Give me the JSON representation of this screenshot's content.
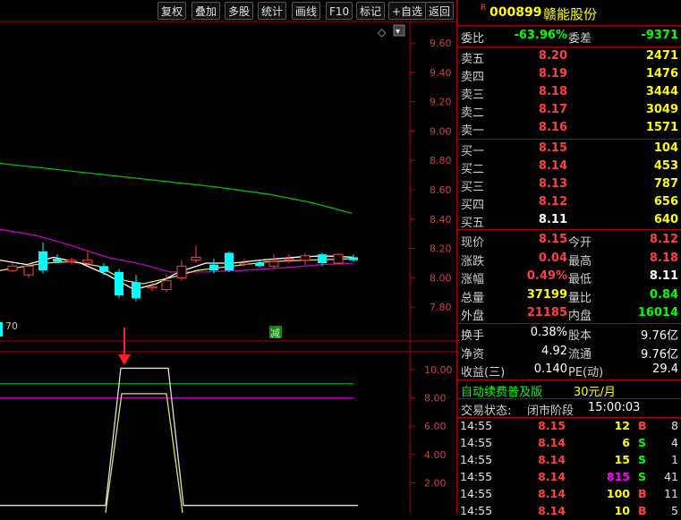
{
  "toolbar": {
    "buttons": [
      "复权",
      "叠加",
      "多股",
      "统计",
      "画线",
      "F10",
      "标记",
      "+自选",
      "返回"
    ]
  },
  "chart": {
    "price_axis": [
      "9.60",
      "9.40",
      "9.20",
      "9.00",
      "8.80",
      "8.60",
      "8.40",
      "8.20",
      "8.00",
      "7.80"
    ],
    "indicator_axis": [
      "10.00",
      "8.00",
      "6.00",
      "4.00",
      "2.00"
    ],
    "left_label": "70",
    "marker_text": "减",
    "diamond_icon": "◇",
    "dropdown_icon": "▾"
  },
  "stock": {
    "badge": "R",
    "code": "000899",
    "name": "赣能股份",
    "weibi_label": "委比",
    "weibi": "-63.96%",
    "weicha_label": "委差",
    "weicha": "-9371"
  },
  "asks": [
    {
      "label": "卖五",
      "price": "8.20",
      "vol": "2471"
    },
    {
      "label": "卖四",
      "price": "8.19",
      "vol": "1476"
    },
    {
      "label": "卖三",
      "price": "8.18",
      "vol": "3444"
    },
    {
      "label": "卖二",
      "price": "8.17",
      "vol": "3049"
    },
    {
      "label": "卖一",
      "price": "8.16",
      "vol": "1571"
    }
  ],
  "bids": [
    {
      "label": "买一",
      "price": "8.15",
      "vol": "104"
    },
    {
      "label": "买二",
      "price": "8.14",
      "vol": "453"
    },
    {
      "label": "买三",
      "price": "8.13",
      "vol": "787"
    },
    {
      "label": "买四",
      "price": "8.12",
      "vol": "656"
    },
    {
      "label": "买五",
      "price": "8.11",
      "vol": "640"
    }
  ],
  "quote": [
    {
      "l1": "现价",
      "v1": "8.15",
      "c1": "red",
      "l2": "今开",
      "v2": "8.12",
      "c2": "red"
    },
    {
      "l1": "涨跌",
      "v1": "0.04",
      "c1": "red",
      "l2": "最高",
      "v2": "8.18",
      "c2": "red"
    },
    {
      "l1": "涨幅",
      "v1": "0.49%",
      "c1": "red",
      "l2": "最低",
      "v2": "8.11",
      "c2": "white"
    },
    {
      "l1": "总量",
      "v1": "37199",
      "c1": "yellow",
      "l2": "量比",
      "v2": "0.84",
      "c2": "green"
    },
    {
      "l1": "外盘",
      "v1": "21185",
      "c1": "red",
      "l2": "内盘",
      "v2": "16014",
      "c2": "green"
    }
  ],
  "fundamentals": [
    {
      "l1": "换手",
      "v1": "0.38%",
      "l2": "股本",
      "v2": "9.76亿"
    },
    {
      "l1": "净资",
      "v1": "4.92",
      "l2": "流通",
      "v2": "9.76亿"
    },
    {
      "l1": "收益(三)",
      "v1": "0.140",
      "l2": "PE(动)",
      "v2": "29.4"
    }
  ],
  "promo": {
    "text": "自动续费普及版",
    "price": "30元/月"
  },
  "status": {
    "label": "交易状态:",
    "phase": "闭市阶段",
    "time": "15:00:03"
  },
  "ticks": [
    {
      "time": "14:55",
      "price": "8.15",
      "vol": "12",
      "vc": "yellow",
      "bs": "B",
      "bsc": "red",
      "n": "8"
    },
    {
      "time": "14:55",
      "price": "8.14",
      "vol": "6",
      "vc": "yellow",
      "bs": "S",
      "bsc": "green",
      "n": "4"
    },
    {
      "time": "14:55",
      "price": "8.14",
      "vol": "15",
      "vc": "yellow",
      "bs": "S",
      "bsc": "green",
      "n": "1"
    },
    {
      "time": "14:55",
      "price": "8.14",
      "vol": "815",
      "vc": "magenta",
      "bs": "S",
      "bsc": "green",
      "n": "41"
    },
    {
      "time": "14:55",
      "price": "8.14",
      "vol": "100",
      "vc": "yellow",
      "bs": "B",
      "bsc": "red",
      "n": "11"
    },
    {
      "time": "14:55",
      "price": "8.14",
      "vol": "10",
      "vc": "yellow",
      "bs": "B",
      "bsc": "red",
      "n": "5"
    }
  ],
  "colors": {
    "up": "#ff4040",
    "down": "#00ffff",
    "ma_green": "#00c000",
    "ma_magenta": "#c000c0",
    "ma_yellow": "#e0e060",
    "ma_white": "#ffffff",
    "grid": "#b00000"
  }
}
